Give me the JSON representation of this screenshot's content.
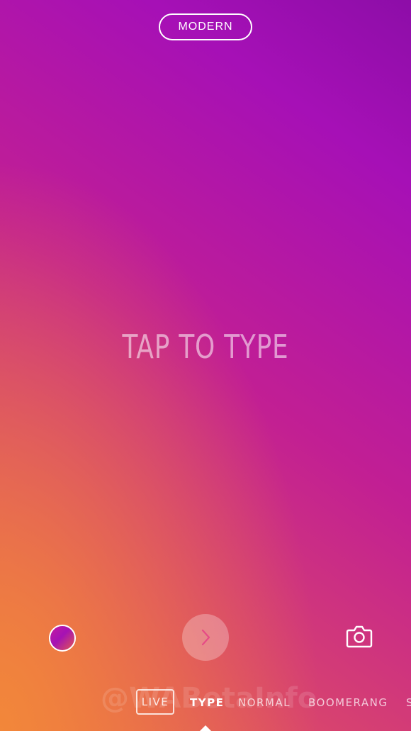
{
  "top": {
    "font_style_label": "MODERN"
  },
  "canvas": {
    "placeholder": "TAP TO TYPE"
  },
  "controls": {
    "gallery_icon": "color-circle-icon",
    "next_icon": "chevron-right-icon",
    "camera_icon": "camera-icon"
  },
  "modes": {
    "items": [
      {
        "label": "LIVE"
      },
      {
        "label": "TYPE"
      },
      {
        "label": "NORMAL"
      },
      {
        "label": "BOOMERANG"
      },
      {
        "label": "S"
      }
    ],
    "selected": "TYPE"
  },
  "watermark": {
    "text": "@WABetaInfo"
  },
  "colors": {
    "gradient_top": "#8d0da8",
    "gradient_mid": "#c21f93",
    "gradient_bottom": "#f2873a"
  }
}
